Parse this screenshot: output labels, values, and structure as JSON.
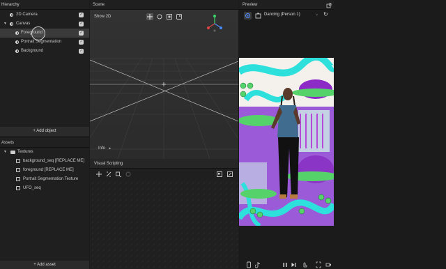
{
  "hierarchy": {
    "title": "Hierarchy",
    "items": [
      {
        "label": "2D Camera",
        "checked": true
      },
      {
        "label": "Canvas",
        "checked": true
      },
      {
        "label": "Foreground",
        "checked": true
      },
      {
        "label": "Portrait Segmentation",
        "checked": true
      },
      {
        "label": "Background",
        "checked": true
      }
    ],
    "add_object": "+ Add object"
  },
  "assets": {
    "title": "Assets",
    "folder": "Textures",
    "items": [
      {
        "label": "background_seq [REPLACE ME]"
      },
      {
        "label": "foreground [REPLACE ME]"
      },
      {
        "label": "Portrait Segmentation Texture"
      },
      {
        "label": "UFO_seq"
      }
    ],
    "add_asset": "+ Add asset"
  },
  "scene": {
    "title": "Scene",
    "show2d": "Show 2D",
    "info": "Info",
    "info_arrow": "▸"
  },
  "visual_scripting": {
    "title": "Visual Scripting"
  },
  "preview": {
    "title": "Preview",
    "device": "Dancing (Person 1)",
    "chevron": "⌄",
    "refresh": "↻"
  },
  "colors": {
    "accent": "#4a8cff",
    "gizmo_y": "#3fd16a",
    "gizmo_x": "#e04545",
    "gizmo_z": "#4a8cff"
  }
}
